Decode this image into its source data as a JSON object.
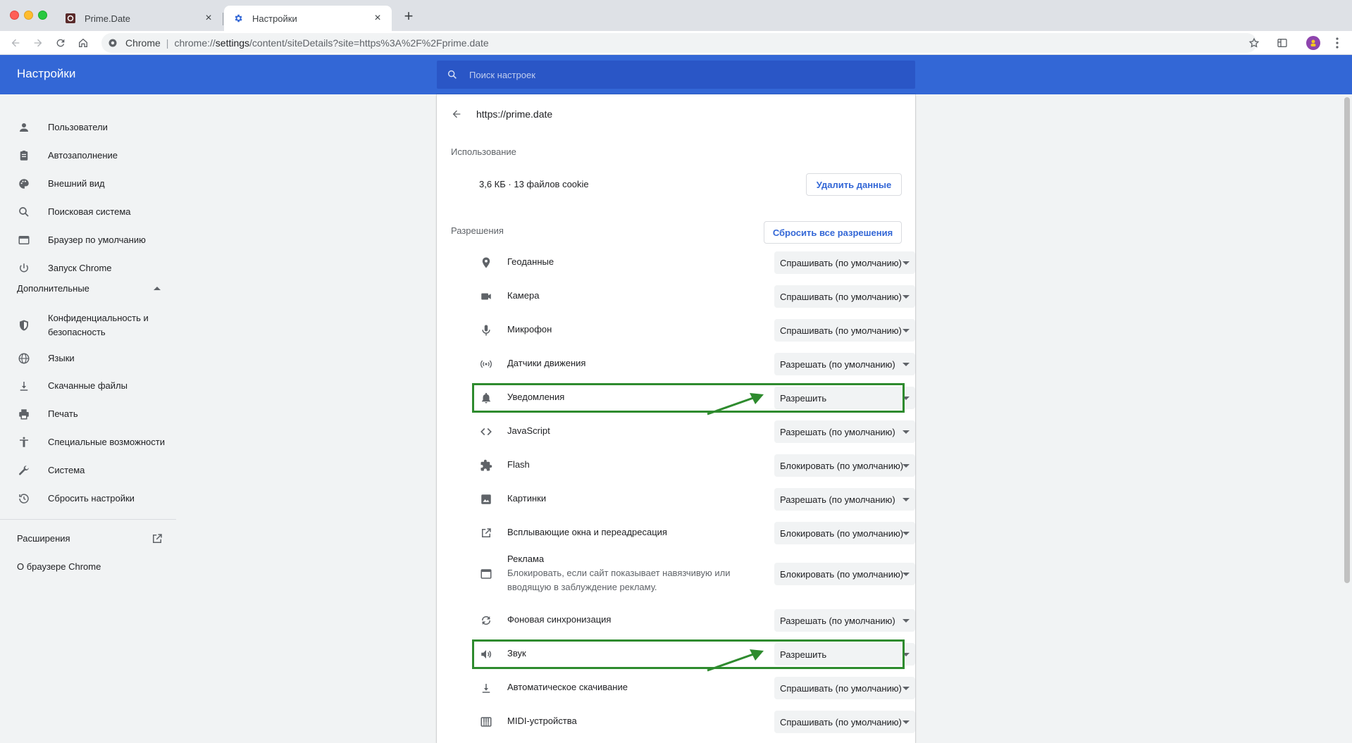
{
  "tabs": [
    {
      "title": "Prime.Date",
      "active": false
    },
    {
      "title": "Настройки",
      "active": true
    }
  ],
  "omnibox": {
    "chip": "Chrome",
    "url_scheme": "chrome://",
    "url_host": "settings",
    "url_path": "/content/siteDetails?site=https%3A%2F%2Fprime.date"
  },
  "header": {
    "title": "Настройки",
    "search_placeholder": "Поиск настроек"
  },
  "sidebar": {
    "items": [
      {
        "label": "Пользователи",
        "icon": "person-icon"
      },
      {
        "label": "Автозаполнение",
        "icon": "clipboard-icon"
      },
      {
        "label": "Внешний вид",
        "icon": "palette-icon"
      },
      {
        "label": "Поисковая система",
        "icon": "search-icon"
      },
      {
        "label": "Браузер по умолчанию",
        "icon": "browser-icon"
      },
      {
        "label": "Запуск Chrome",
        "icon": "power-icon"
      }
    ],
    "advanced_label": "Дополнительные",
    "advanced_items": [
      {
        "label": "Конфиденциальность и безопасность",
        "icon": "shield-icon"
      },
      {
        "label": "Языки",
        "icon": "globe-icon"
      },
      {
        "label": "Скачанные файлы",
        "icon": "download-icon"
      },
      {
        "label": "Печать",
        "icon": "printer-icon"
      },
      {
        "label": "Специальные возможности",
        "icon": "accessibility-icon"
      },
      {
        "label": "Система",
        "icon": "wrench-icon"
      },
      {
        "label": "Сбросить настройки",
        "icon": "history-icon"
      }
    ],
    "extensions_label": "Расширения",
    "about_label": "О браузере Chrome"
  },
  "site": {
    "title": "https://prime.date",
    "usage_label": "Использование",
    "usage_value": "3,6 КБ · 13 файлов cookie",
    "delete_button": "Удалить данные",
    "permissions_label": "Разрешения",
    "reset_button": "Сбросить все разрешения",
    "permissions": [
      {
        "label": "Геоданные",
        "value": "Спрашивать (по умолчанию)",
        "icon": "location-icon"
      },
      {
        "label": "Камера",
        "value": "Спрашивать (по умолчанию)",
        "icon": "camera-icon"
      },
      {
        "label": "Микрофон",
        "value": "Спрашивать (по умолчанию)",
        "icon": "microphone-icon"
      },
      {
        "label": "Датчики движения",
        "value": "Разрешать (по умолчанию)",
        "icon": "sensors-icon"
      },
      {
        "label": "Уведомления",
        "value": "Разрешить",
        "icon": "bell-icon",
        "highlighted": true
      },
      {
        "label": "JavaScript",
        "value": "Разрешать (по умолчанию)",
        "icon": "code-icon"
      },
      {
        "label": "Flash",
        "value": "Блокировать (по умолчанию)",
        "icon": "puzzle-icon"
      },
      {
        "label": "Картинки",
        "value": "Разрешать (по умолчанию)",
        "icon": "image-icon"
      },
      {
        "label": "Всплывающие окна и переадресация",
        "value": "Блокировать (по умолчанию)",
        "icon": "open-in-new-icon"
      },
      {
        "label": "Реклама",
        "sublabel": "Блокировать, если сайт показывает навязчивую или вводящую в заблуждение рекламу.",
        "value": "Блокировать (по умолчанию)",
        "icon": "ads-icon"
      },
      {
        "label": "Фоновая синхронизация",
        "value": "Разрешать (по умолчанию)",
        "icon": "sync-icon"
      },
      {
        "label": "Звук",
        "value": "Разрешить",
        "icon": "volume-icon",
        "highlighted": true
      },
      {
        "label": "Автоматическое скачивание",
        "value": "Спрашивать (по умолчанию)",
        "icon": "download-icon"
      },
      {
        "label": "MIDI-устройства",
        "value": "Спрашивать (по умолчанию)",
        "icon": "piano-icon"
      }
    ]
  },
  "colors": {
    "header_blue": "#3367d6",
    "link_blue": "#3367d6",
    "highlight_green": "#2e8b2e"
  }
}
